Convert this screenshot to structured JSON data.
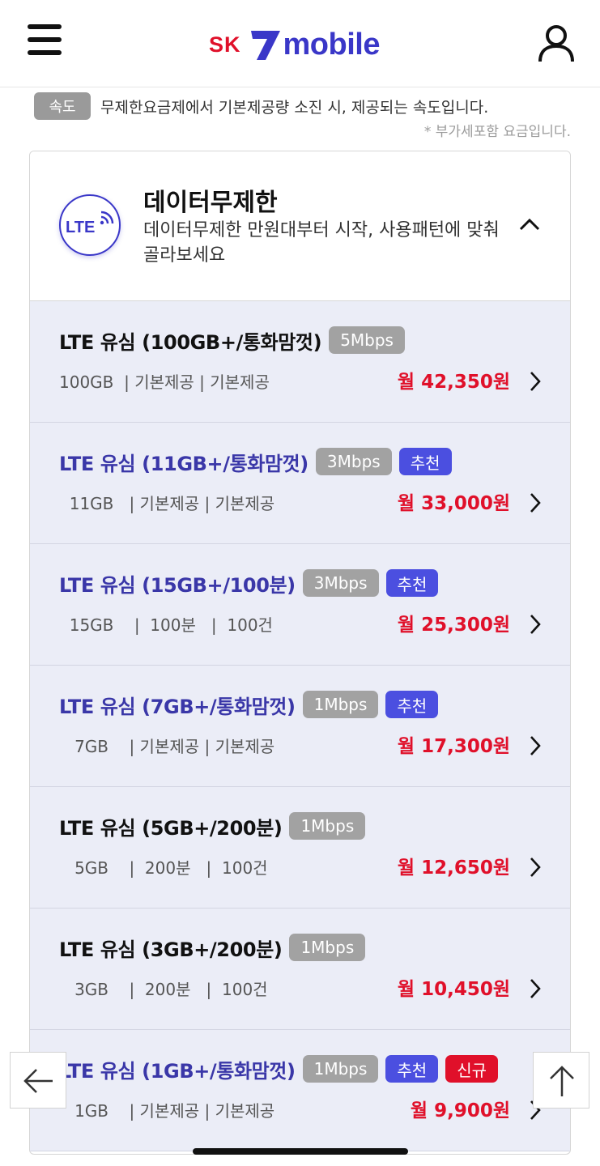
{
  "header": {
    "logo_sk": "SK",
    "logo_word": "mobile",
    "menu_icon": "hamburger-menu-icon",
    "user_icon": "user-profile-icon"
  },
  "info": {
    "speed_label": "속도",
    "speed_desc": "무제한요금제에서 기본제공량 소진 시, 제공되는 속도입니다.",
    "vat_note": "* 부가세포함 요금입니다."
  },
  "section": {
    "icon_text": "LTE",
    "title": "데이터무제한",
    "subtitle": "데이터무제한 만원대부터 시작, 사용패턴에 맞춰 골라보세요",
    "toggle_icon": "chevron-up-icon"
  },
  "plans": [
    {
      "name": "LTE 유심 (100GB+/통화맘껏)",
      "speed": "5Mbps",
      "badges": [],
      "spec": "100GB  | 기본제공 | 기본제공",
      "price": "월 42,350원",
      "highlight": false
    },
    {
      "name": "LTE 유심 (11GB+/통화맘껏)",
      "speed": "3Mbps",
      "badges": [
        "추천"
      ],
      "spec": "  11GB   | 기본제공 | 기본제공",
      "price": "월 33,000원",
      "highlight": true
    },
    {
      "name": "LTE 유심 (15GB+/100분)",
      "speed": "3Mbps",
      "badges": [
        "추천"
      ],
      "spec": "  15GB    |  100분   |  100건",
      "price": "월 25,300원",
      "highlight": true
    },
    {
      "name": "LTE 유심 (7GB+/통화맘껏)",
      "speed": "1Mbps",
      "badges": [
        "추천"
      ],
      "spec": "   7GB    | 기본제공 | 기본제공",
      "price": "월 17,300원",
      "highlight": true
    },
    {
      "name": "LTE 유심 (5GB+/200분)",
      "speed": "1Mbps",
      "badges": [],
      "spec": "   5GB    |  200분   |  100건",
      "price": "월 12,650원",
      "highlight": false
    },
    {
      "name": "LTE 유심 (3GB+/200분)",
      "speed": "1Mbps",
      "badges": [],
      "spec": "   3GB    |  200분   |  100건",
      "price": "월 10,450원",
      "highlight": false
    },
    {
      "name": "LTE 유심 (1GB+/통화맘껏)",
      "speed": "1Mbps",
      "badges": [
        "추천",
        "신규"
      ],
      "spec": "   1GB    | 기본제공 | 기본제공",
      "price": "월 9,900원",
      "highlight": true
    }
  ],
  "colors": {
    "brand_blue": "#3a37c8",
    "brand_red": "#e0102a",
    "badge_recommend": "#4b4fe0",
    "badge_new": "#e0102a",
    "badge_speed": "#a2a2a2",
    "plan_bg": "#ebedf7"
  },
  "floating": {
    "back_icon": "arrow-left-icon",
    "top_icon": "arrow-up-icon"
  }
}
